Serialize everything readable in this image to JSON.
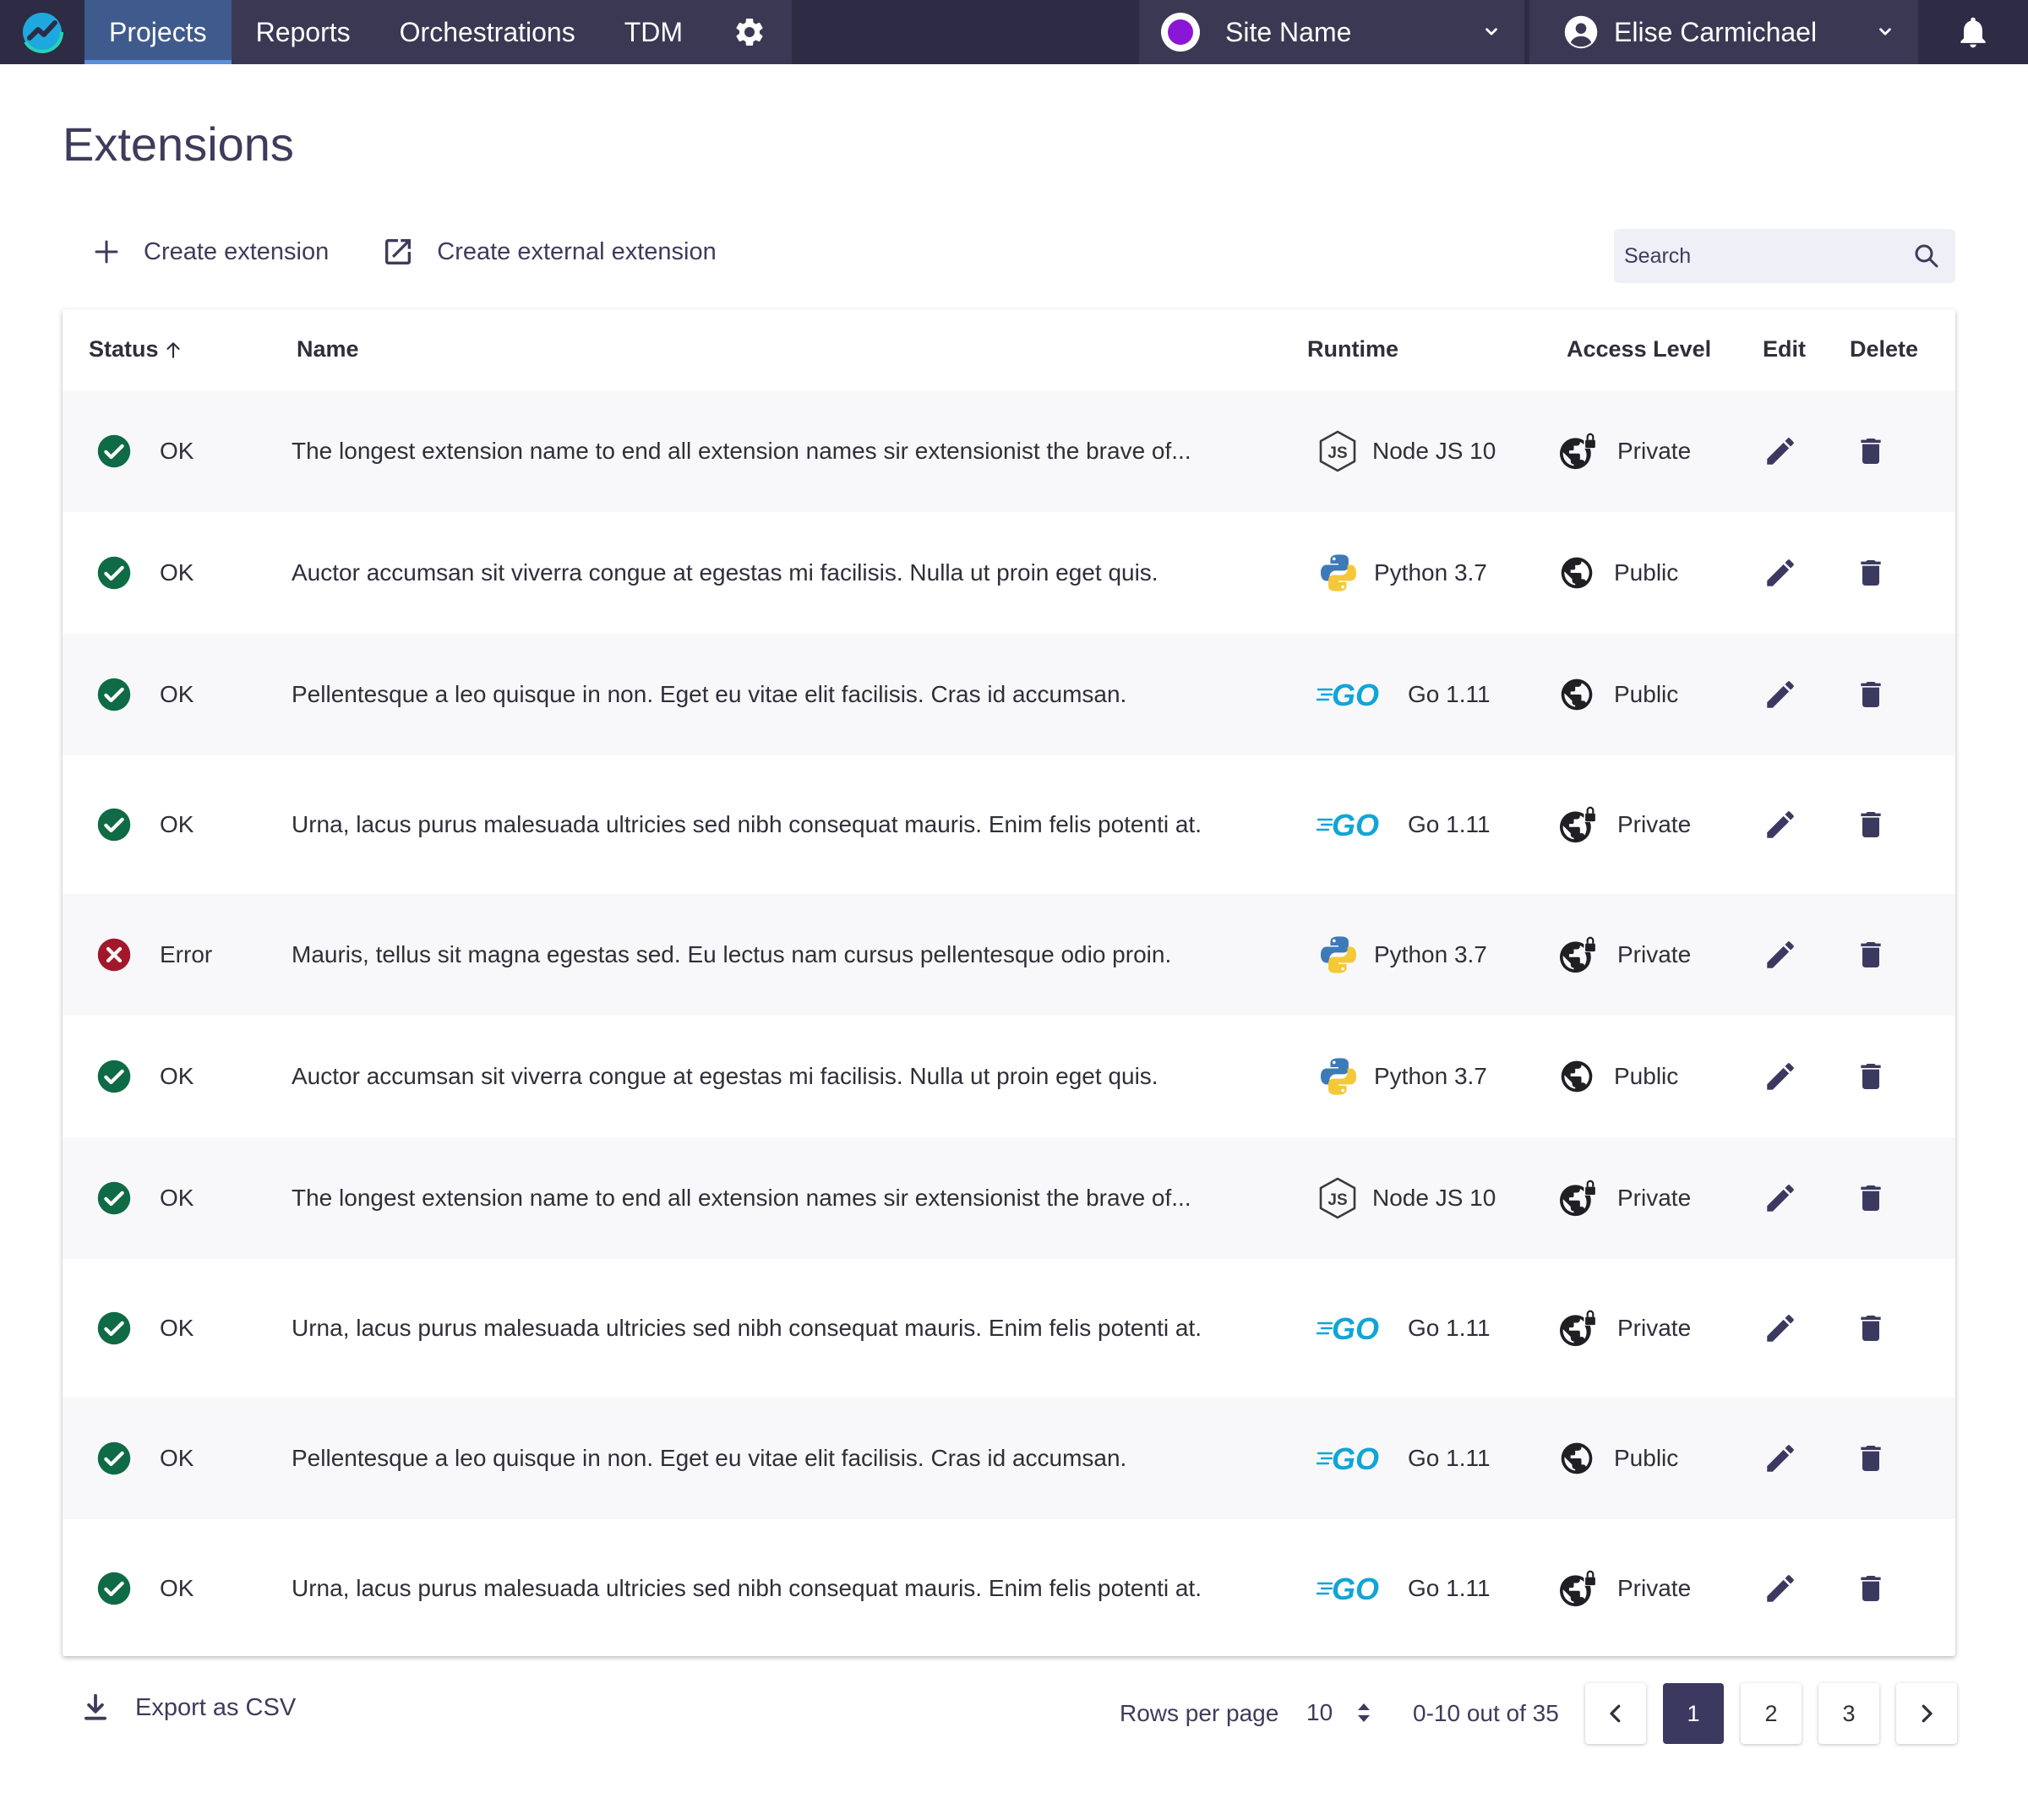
{
  "topbar": {
    "logo_icon": "app-logo-icon",
    "tabs": [
      {
        "label": "Projects",
        "active": true
      },
      {
        "label": "Reports",
        "active": false
      },
      {
        "label": "Orchestrations",
        "active": false
      },
      {
        "label": "TDM",
        "active": false
      }
    ],
    "settings_icon": "gear-icon",
    "site": {
      "label": "Site Name",
      "dot_color": "#8a17d6"
    },
    "user": {
      "label": "Elise Carmichael"
    },
    "notifications_icon": "bell-icon"
  },
  "page": {
    "title": "Extensions",
    "create_extension": "Create extension",
    "create_external_extension": "Create external extension",
    "search_placeholder": "Search"
  },
  "table": {
    "columns": {
      "status": "Status",
      "name": "Name",
      "runtime": "Runtime",
      "access": "Access Level",
      "edit": "Edit",
      "delete": "Delete"
    },
    "rows": [
      {
        "status": "OK",
        "name": "The longest extension name to end all extension names sir extensionist the brave of...",
        "runtime": "Node JS 10",
        "runtime_icon": "nodejs-icon",
        "access": "Private"
      },
      {
        "status": "OK",
        "name": "Auctor accumsan sit viverra congue at egestas mi facilisis. Nulla ut proin eget quis.",
        "runtime": "Python 3.7",
        "runtime_icon": "python-icon",
        "access": "Public"
      },
      {
        "status": "OK",
        "name": "Pellentesque a leo quisque in non. Eget eu vitae elit facilisis. Cras id accumsan.",
        "runtime": "Go 1.11",
        "runtime_icon": "go-icon",
        "access": "Public"
      },
      {
        "status": "OK",
        "name": "Urna, lacus purus malesuada ultricies sed nibh consequat mauris. Enim felis potenti at.",
        "runtime": "Go 1.11",
        "runtime_icon": "go-icon",
        "access": "Private"
      },
      {
        "status": "Error",
        "name": "Mauris, tellus sit magna egestas sed. Eu lectus nam cursus pellentesque odio proin.",
        "runtime": "Python 3.7",
        "runtime_icon": "python-icon",
        "access": "Private"
      },
      {
        "status": "OK",
        "name": "Auctor accumsan sit viverra congue at egestas mi facilisis. Nulla ut proin eget quis.",
        "runtime": "Python 3.7",
        "runtime_icon": "python-icon",
        "access": "Public"
      },
      {
        "status": "OK",
        "name": "The longest extension name to end all extension names sir extensionist the brave of...",
        "runtime": "Node JS 10",
        "runtime_icon": "nodejs-icon",
        "access": "Private"
      },
      {
        "status": "OK",
        "name": "Urna, lacus purus malesuada ultricies sed nibh consequat mauris. Enim felis potenti at.",
        "runtime": "Go 1.11",
        "runtime_icon": "go-icon",
        "access": "Private"
      },
      {
        "status": "OK",
        "name": "Pellentesque a leo quisque in non. Eget eu vitae elit facilisis. Cras id accumsan.",
        "runtime": "Go 1.11",
        "runtime_icon": "go-icon",
        "access": "Public"
      },
      {
        "status": "OK",
        "name": "Urna, lacus purus malesuada ultricies sed nibh consequat mauris. Enim felis potenti at.",
        "runtime": "Go 1.11",
        "runtime_icon": "go-icon",
        "access": "Private"
      }
    ]
  },
  "footer": {
    "export_label": "Export as CSV",
    "rows_per_page_label": "Rows per page",
    "rows_per_page_value": "10",
    "range_text": "0-10 out of 35",
    "pages": [
      "1",
      "2",
      "3"
    ],
    "current_page": "1"
  },
  "colors": {
    "topbar": "#2e2b45",
    "accent": "#3c3961",
    "ok": "#0f6b45",
    "error": "#a3172b"
  }
}
